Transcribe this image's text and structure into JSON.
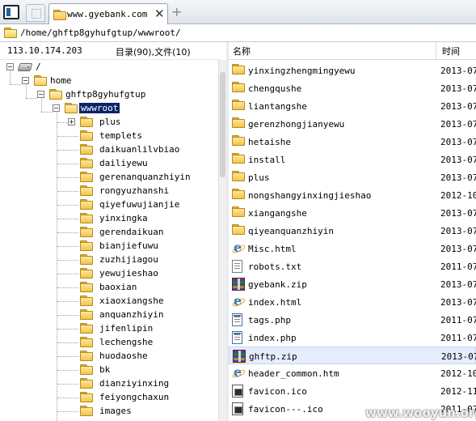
{
  "tabbar": {
    "tab_title": "www.gyebank.com",
    "close_glyph": "✕",
    "add_glyph": "+"
  },
  "address": {
    "path": "/home/ghftp8gyhufgtup/wwwroot/"
  },
  "left_header": {
    "ip": "113.10.174.203",
    "counts": "目录(90),文件(10)"
  },
  "tree": {
    "root": "/",
    "home": "home",
    "user": "ghftp8gyhufgtup",
    "selected": "wwwroot",
    "children": [
      "plus",
      "templets",
      "daikuanlilvbiao",
      "dailiyewu",
      "gerenanquanzhiyin",
      "rongyuzhanshi",
      "qiyefuwujianjie",
      "yinxingka",
      "gerendaikuan",
      "bianjiefuwu",
      "zuzhijiagou",
      "yewujieshao",
      "baoxian",
      "xiaoxiangshe",
      "anquanzhiyin",
      "jifenlipin",
      "lechengshe",
      "huodaoshe",
      "bk",
      "dianziyinxing",
      "feiyongchaxun",
      "images"
    ]
  },
  "columns": {
    "name": "名称",
    "time": "时间"
  },
  "files": [
    {
      "icon": "folder-icon",
      "name": "yinxingzhengmingyewu",
      "time": "2013-07-"
    },
    {
      "icon": "folder-icon",
      "name": "chengqushe",
      "time": "2013-07-"
    },
    {
      "icon": "folder-icon",
      "name": "liantangshe",
      "time": "2013-07-"
    },
    {
      "icon": "folder-icon",
      "name": "gerenzhongjianyewu",
      "time": "2013-07-"
    },
    {
      "icon": "folder-icon",
      "name": "hetaishe",
      "time": "2013-07-"
    },
    {
      "icon": "folder-icon",
      "name": "install",
      "time": "2013-07-"
    },
    {
      "icon": "folder-icon",
      "name": "plus",
      "time": "2013-07-"
    },
    {
      "icon": "folder-icon",
      "name": "nongshangyinxingjieshao",
      "time": "2012-10-"
    },
    {
      "icon": "folder-icon",
      "name": "xiangangshe",
      "time": "2013-07-"
    },
    {
      "icon": "folder-icon",
      "name": "qiyeanquanzhiyin",
      "time": "2013-07-"
    },
    {
      "icon": "html-file-icon",
      "name": "Misc.html",
      "time": "2013-07-"
    },
    {
      "icon": "text-file-icon",
      "name": "robots.txt",
      "time": "2011-07-"
    },
    {
      "icon": "zip-archive-icon",
      "name": "gyebank.zip",
      "time": "2013-07-"
    },
    {
      "icon": "html-file-icon",
      "name": "index.html",
      "time": "2013-07-"
    },
    {
      "icon": "php-file-icon",
      "name": "tags.php",
      "time": "2011-07-"
    },
    {
      "icon": "php-file-icon",
      "name": "index.php",
      "time": "2011-07-"
    },
    {
      "icon": "zip-archive-icon",
      "name": "ghftp.zip",
      "time": "2013-07-"
    },
    {
      "icon": "html-file-icon",
      "name": "header_common.htm",
      "time": "2012-10-"
    },
    {
      "icon": "ico-file-icon",
      "name": "favicon.ico",
      "time": "2012-11-"
    },
    {
      "icon": "ico-file-icon",
      "name": "favicon---.ico",
      "time": "2011-07-"
    }
  ],
  "selected_file": "ghftp.zip",
  "watermark": "www.wooyun.org"
}
